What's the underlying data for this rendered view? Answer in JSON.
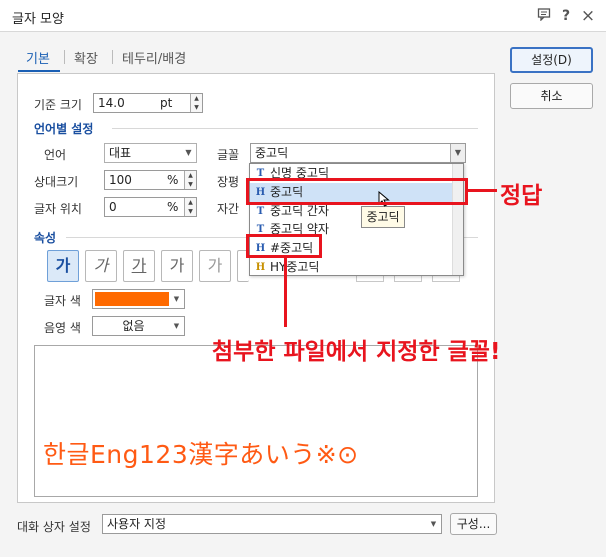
{
  "window": {
    "title": "글자 모양"
  },
  "titlebar_icons": {
    "menu": "message-icon",
    "help_label": "?",
    "close_label": "×"
  },
  "tabs": [
    {
      "label": "기본"
    },
    {
      "label": "확장"
    },
    {
      "label": "테두리/배경"
    }
  ],
  "buttons": {
    "ok": "설정(D)",
    "cancel": "취소",
    "config": "구성..."
  },
  "base_size": {
    "label": "기준 크기",
    "value": "14.0",
    "unit": "pt"
  },
  "lang_section": {
    "title": "언어별 설정",
    "language": {
      "label": "언어",
      "value": "대표"
    },
    "font": {
      "label": "글꼴",
      "value": "중고딕"
    },
    "rel_size": {
      "label": "상대크기",
      "value": "100",
      "unit": "%"
    },
    "position": {
      "label": "글자 위치",
      "value": "0",
      "unit": "%"
    },
    "width_label": "장평",
    "spacing_label": "자간"
  },
  "props_section": {
    "title": "속성",
    "format_buttons": [
      "가",
      "가",
      "가",
      "가",
      "가"
    ],
    "text_color": {
      "label": "글자 색",
      "value": "#ff6a00"
    },
    "shade_color": {
      "label": "음영 색",
      "value": "없음"
    }
  },
  "font_dropdown": {
    "items": [
      {
        "icon": "T",
        "label": "신명 중고딕"
      },
      {
        "icon": "H",
        "label": "중고딕"
      },
      {
        "icon": "T",
        "label": "중고딕 간자"
      },
      {
        "icon": "T",
        "label": "중고딕 약자"
      },
      {
        "icon": "H",
        "label": "#중고딕"
      },
      {
        "icon": "H",
        "label": "HY중고딕"
      }
    ],
    "tooltip": "중고딕"
  },
  "preview": {
    "text": "한글Eng123漢字あいう※⊙"
  },
  "dialog_setting": {
    "label": "대화 상자 설정",
    "value": "사용자 지정"
  },
  "annotations": {
    "correct": "정답",
    "note": "첨부한 파일에서 지정한 글꼴!"
  },
  "colors": {
    "accent": "#1a5fb4",
    "annotation": "#e8141e",
    "preview_text": "#ff5a14"
  }
}
